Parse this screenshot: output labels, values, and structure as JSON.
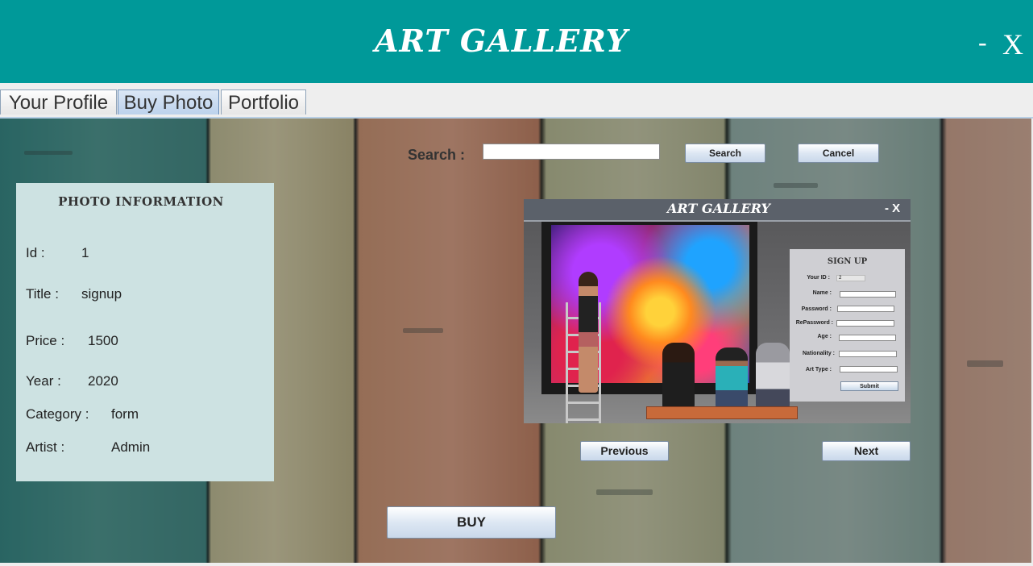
{
  "window": {
    "title": "ART GALLERY",
    "minimize": "-",
    "close": "X"
  },
  "tabs": [
    {
      "label": "Your Profile",
      "active": false
    },
    {
      "label": "Buy Photo",
      "active": true
    },
    {
      "label": "Portfolio",
      "active": false
    }
  ],
  "search": {
    "label": "Search :",
    "value": "",
    "search_button": "Search",
    "cancel_button": "Cancel"
  },
  "info": {
    "heading": "PHOTO INFORMATION",
    "id_label": "Id :",
    "id_value": "1",
    "title_label": "Title :",
    "title_value": "signup",
    "price_label": "Price :",
    "price_value": "1500",
    "year_label": "Year :",
    "year_value": "2020",
    "category_label": "Category :",
    "category_value": "form",
    "artist_label": "Artist :",
    "artist_value": "Admin"
  },
  "preview": {
    "title": "ART GALLERY",
    "controls": "- X",
    "form": {
      "title": "SIGN UP",
      "fields": [
        "Your ID :",
        "Name :",
        "Password :",
        "RePassword :",
        "Age :",
        "Nationality :",
        "Art Type :"
      ],
      "id_value": "2",
      "submit": "Submit"
    }
  },
  "nav": {
    "previous": "Previous",
    "next": "Next",
    "buy": "BUY"
  },
  "colors": {
    "titlebar": "#009999",
    "info_panel": "#cde2e2"
  }
}
